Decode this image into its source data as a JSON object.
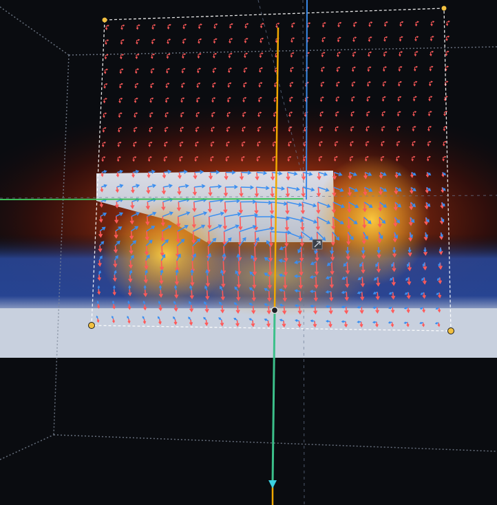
{
  "viewport": {
    "kind": "3D vector field visualization viewport",
    "background": "#0a0c10"
  },
  "colors": {
    "heat_core": "#f0b428",
    "heat_mid": "#c83c10",
    "heat_outer": "#501008",
    "blue_band": "#2a4aa0",
    "slab": "#c8d0de",
    "field_vector_red": "#ff5a5a",
    "field_vector_blue": "#3a8ef0",
    "axis_x": "#3cc05a",
    "axis_y_up": "#3a8ae8",
    "axis_y_down": "#f0a800",
    "gizmo_line": "#3cc08a",
    "handle": "#f2c040",
    "plane_outline": "#ffffff"
  },
  "icons": [
    "control-handle-icon",
    "gizmo-pivot-icon",
    "gizmo-arrow-icon",
    "scale-handle-icon"
  ]
}
